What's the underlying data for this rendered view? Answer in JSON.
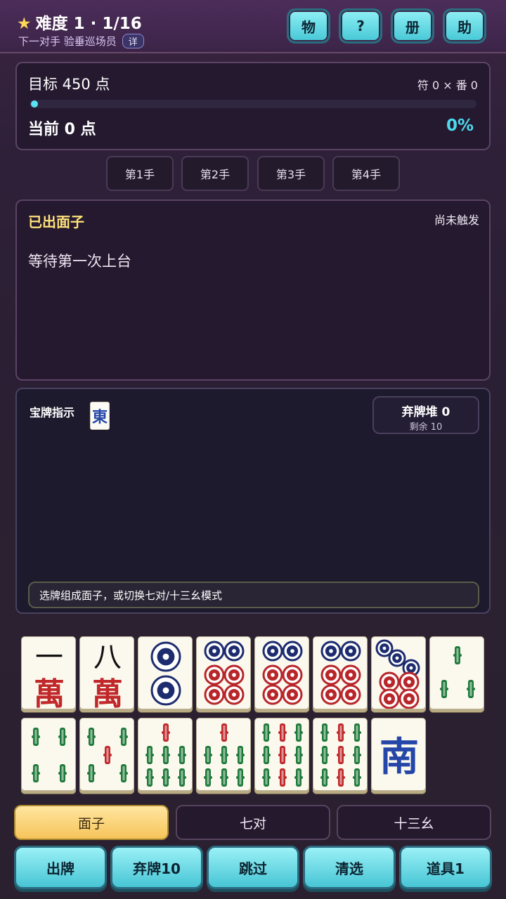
{
  "header": {
    "level_title": "难度 1 · 1/16",
    "next_opponent": "下一对手 验垂巡场员",
    "detail_badge": "详",
    "buttons": [
      "物",
      "?",
      "册",
      "助"
    ]
  },
  "score": {
    "target": "目标 450 点",
    "fu_han": "符 0 × 番 0",
    "current": "当前 0 点",
    "percent": "0%",
    "progress": 0
  },
  "hands": [
    "第1手",
    "第2手",
    "第3手",
    "第4手"
  ],
  "melds": {
    "title": "已出面子",
    "status": "尚未触发",
    "empty_text": "等待第一次上台"
  },
  "table": {
    "dora_label": "宝牌指示",
    "dora_tile": "東",
    "discard_pile": "弃牌堆 0",
    "discard_remaining": "剩余 10",
    "hint": "选牌组成面子，或切换七对/十三幺模式"
  },
  "hand_tiles": [
    {
      "suit": "man",
      "rank": 1,
      "glyph": "一",
      "label": "萬"
    },
    {
      "suit": "man",
      "rank": 8,
      "glyph": "八",
      "label": "萬"
    },
    {
      "suit": "pin",
      "rank": 2
    },
    {
      "suit": "pin",
      "rank": 6
    },
    {
      "suit": "pin",
      "rank": 6
    },
    {
      "suit": "pin",
      "rank": 6
    },
    {
      "suit": "pin",
      "rank": 7
    },
    {
      "suit": "sou",
      "rank": 3
    },
    {
      "suit": "sou",
      "rank": 4
    },
    {
      "suit": "sou",
      "rank": 5
    },
    {
      "suit": "sou",
      "rank": 7
    },
    {
      "suit": "sou",
      "rank": 7
    },
    {
      "suit": "sou",
      "rank": 9
    },
    {
      "suit": "sou",
      "rank": 9
    },
    {
      "suit": "honor",
      "glyph": "南"
    }
  ],
  "modes": [
    "面子",
    "七对",
    "十三幺"
  ],
  "active_mode": 0,
  "actions": [
    "出牌",
    "弃牌10",
    "跳过",
    "清选",
    "道具1"
  ],
  "colors": {
    "accent": "#47c5d5",
    "mode_active": "#f6c45a",
    "man_red": "#c0282a",
    "pin_blue": "#1d2c6e",
    "sou_green": "#1f7a3a",
    "dora_blue": "#2446a8"
  }
}
